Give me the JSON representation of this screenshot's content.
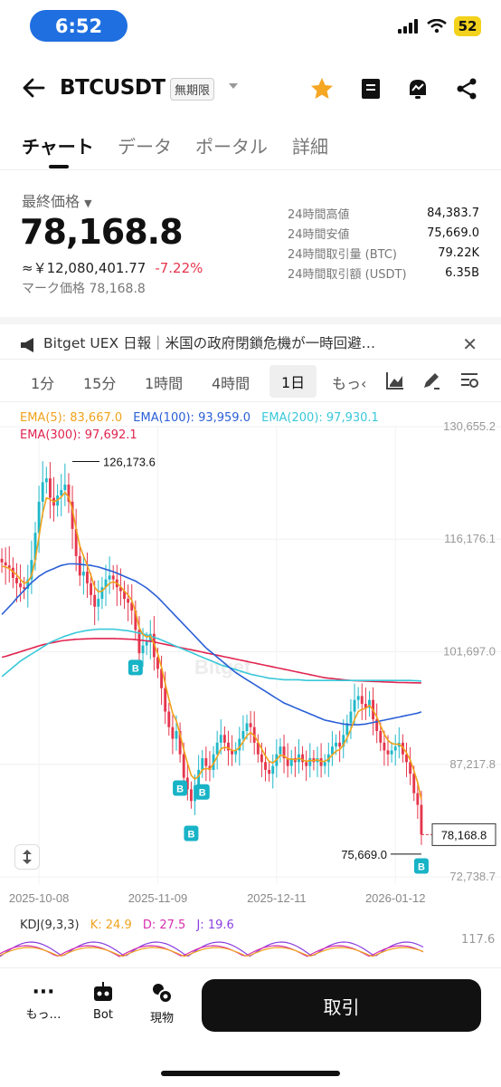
{
  "status_bar": {
    "time": "6:52",
    "battery": "52"
  },
  "header": {
    "symbol": "BTCUSDT",
    "contract_tag": "無期限"
  },
  "tabs": [
    {
      "label": "チャート",
      "active": true
    },
    {
      "label": "データ",
      "active": false
    },
    {
      "label": "ポータル",
      "active": false
    },
    {
      "label": "詳細",
      "active": false
    }
  ],
  "price": {
    "last_label": "最終価格",
    "last_price": "78,168.8",
    "yen_price": "≈￥12,080,401.77",
    "change_pct": "-7.22%",
    "mark_label": "マーク価格",
    "mark_price": "78,168.8"
  },
  "stats": [
    {
      "label": "24時間高値",
      "value": "84,383.7"
    },
    {
      "label": "24時間安値",
      "value": "75,669.0"
    },
    {
      "label": "24時間取引量 (BTC)",
      "value": "79.22K"
    },
    {
      "label": "24時間取引額 (USDT)",
      "value": "6.35B"
    }
  ],
  "news": {
    "text": "Bitget UEX 日報｜米国の政府閉鎖危機が一時回避…"
  },
  "intervals": [
    {
      "label": "1分",
      "active": false
    },
    {
      "label": "15分",
      "active": false
    },
    {
      "label": "1時間",
      "active": false
    },
    {
      "label": "4時間",
      "active": false
    },
    {
      "label": "1日",
      "active": true
    },
    {
      "label": "もっ‹",
      "active": false
    }
  ],
  "colors": {
    "up": "#1fb8c9",
    "down": "#e5364d",
    "ema5": "#f0a21c",
    "ema100": "#2a5fd6",
    "ema200": "#39c8d9",
    "ema300": "#e0244f",
    "kdj_k": "#f0a21c",
    "kdj_d": "#d62fb0",
    "kdj_j": "#8a3fe0"
  },
  "ema_legend": [
    {
      "text": "EMA(5): 83,667.0",
      "color": "#f0a21c"
    },
    {
      "text": "EMA(100): 93,959.0",
      "color": "#2a5fd6"
    },
    {
      "text": "EMA(200): 97,930.1",
      "color": "#39c8d9"
    },
    {
      "text": "EMA(300): 97,692.1",
      "color": "#e0244f"
    }
  ],
  "watermark": "Bitget",
  "chart_data": {
    "type": "candlestick",
    "y_ticks": [
      130655.2,
      116176.1,
      101697.0,
      87217.8,
      72738.7
    ],
    "y_tick_labels": [
      "130,655.2",
      "116,176.1",
      "101,697.0",
      "87,217.8",
      "72,738.7"
    ],
    "ylim": [
      72738.7,
      130655.2
    ],
    "x_tick_labels": [
      "2025-10-08",
      "2025-11-09",
      "2025-12-11",
      "2026-01-12"
    ],
    "x_tick_index": [
      10,
      42,
      74,
      106
    ],
    "high_label": "126,173.6",
    "high_value": 126173.6,
    "high_index": 19,
    "low_label": "75,669.0",
    "low_value": 75669.0,
    "current_label": "78,168.8",
    "current_value": 78168.8,
    "closes": [
      113200,
      112800,
      112500,
      111200,
      110500,
      110000,
      109800,
      111000,
      113500,
      117000,
      121000,
      123500,
      124000,
      121500,
      120500,
      121800,
      122500,
      123200,
      121000,
      117500,
      114000,
      111500,
      112000,
      110500,
      109000,
      107500,
      108500,
      110000,
      111000,
      111500,
      111000,
      110000,
      109500,
      108500,
      108000,
      107000,
      104500,
      101500,
      102500,
      103000,
      104000,
      101000,
      99500,
      97000,
      94000,
      92000,
      90500,
      91500,
      88500,
      85500,
      84000,
      82500,
      84500,
      86500,
      88000,
      87000,
      86500,
      88500,
      90000,
      91000,
      90000,
      89000,
      88500,
      89000,
      90500,
      91500,
      92500,
      92000,
      90000,
      88500,
      87500,
      86500,
      86000,
      87000,
      88500,
      89500,
      88000,
      87000,
      88000,
      87500,
      88500,
      87500,
      87000,
      88000,
      87500,
      88000,
      87000,
      87500,
      88500,
      89500,
      90000,
      89500,
      91000,
      92500,
      94000,
      95500,
      96000,
      95000,
      94500,
      95500,
      93000,
      91500,
      90000,
      89000,
      88500,
      89000,
      89500,
      90000,
      88500,
      87500,
      86000,
      83500,
      82000,
      78168.8
    ],
    "ema5": [
      112700,
      112600,
      112400,
      112000,
      111600,
      111000,
      110500,
      110700,
      111500,
      113500,
      116500,
      119500,
      121500,
      121300,
      121000,
      121200,
      121600,
      122200,
      121600,
      120000,
      117500,
      115300,
      114000,
      112800,
      111500,
      110000,
      109400,
      109500,
      110000,
      110500,
      110700,
      110500,
      110100,
      109500,
      109000,
      108300,
      106900,
      104800,
      103900,
      103600,
      103700,
      102700,
      101400,
      99700,
      97600,
      95600,
      93800,
      92800,
      91100,
      89100,
      87400,
      85800,
      85300,
      85700,
      86500,
      86700,
      86600,
      87300,
      88200,
      89200,
      89400,
      89300,
      89000,
      89000,
      89400,
      90100,
      90900,
      91300,
      90900,
      90100,
      89200,
      88300,
      87600,
      87400,
      87800,
      88400,
      88300,
      87900,
      87900,
      87800,
      88000,
      87800,
      87600,
      87700,
      87700,
      87800,
      87600,
      87600,
      87900,
      88400,
      88900,
      89100,
      89700,
      90600,
      91700,
      93000,
      94000,
      94300,
      94400,
      94800,
      94200,
      93300,
      92200,
      91100,
      90300,
      89900,
      89800,
      89800,
      89400,
      88700,
      87800,
      86400,
      84900,
      82700
    ],
    "ema100": [
      106500,
      107000,
      107500,
      108000,
      108600,
      109100,
      109600,
      110100,
      110600,
      111000,
      111400,
      111700,
      112000,
      112200,
      112400,
      112600,
      112800,
      112900,
      113000,
      113000,
      113000,
      112950,
      112900,
      112850,
      112800,
      112700,
      112600,
      112450,
      112300,
      112150,
      112000,
      111800,
      111600,
      111400,
      111200,
      111000,
      110800,
      110500,
      110200,
      109900,
      109500,
      109100,
      108700,
      108200,
      107700,
      107200,
      106700,
      106200,
      105700,
      105200,
      104700,
      104200,
      103700,
      103200,
      102700,
      102200,
      101800,
      101400,
      101000,
      100600,
      100200,
      99800,
      99400,
      99000,
      98700,
      98400,
      98100,
      97800,
      97500,
      97200,
      96900,
      96600,
      96300,
      96000,
      95700,
      95400,
      95100,
      94900,
      94700,
      94500,
      94300,
      94100,
      93900,
      93700,
      93500,
      93300,
      93100,
      92900,
      92800,
      92700,
      92600,
      92500,
      92400,
      92350,
      92300,
      92300,
      92300,
      92350,
      92400,
      92500,
      92600,
      92700,
      92800,
      92900,
      93000,
      93100,
      93200,
      93300,
      93400,
      93500,
      93600,
      93700,
      93800,
      93959
    ],
    "ema200": [
      98500,
      98900,
      99300,
      99700,
      100100,
      100500,
      100800,
      101100,
      101400,
      101700,
      102000,
      102300,
      102600,
      102900,
      103100,
      103300,
      103500,
      103700,
      103850,
      104000,
      104150,
      104250,
      104350,
      104450,
      104500,
      104550,
      104600,
      104600,
      104600,
      104600,
      104600,
      104550,
      104500,
      104450,
      104400,
      104300,
      104200,
      104100,
      104000,
      103850,
      103700,
      103550,
      103400,
      103200,
      103000,
      102800,
      102600,
      102400,
      102200,
      102000,
      101800,
      101600,
      101400,
      101200,
      101000,
      100800,
      100600,
      100400,
      100200,
      100000,
      99850,
      99700,
      99550,
      99400,
      99250,
      99100,
      98950,
      98800,
      98700,
      98600,
      98500,
      98400,
      98300,
      98250,
      98200,
      98150,
      98100,
      98100,
      98100,
      98100,
      98100,
      98050,
      98000,
      98000,
      98000,
      98000,
      98000,
      98000,
      98000,
      98000,
      98000,
      98000,
      98000,
      98000,
      98000,
      98000,
      98000,
      98000,
      98000,
      98000,
      98000,
      98000,
      98000,
      98000,
      98000,
      98000,
      98000,
      98000,
      98000,
      98000,
      98000,
      97980,
      97960,
      97930.1
    ],
    "ema300": [
      101000,
      101100,
      101250,
      101400,
      101550,
      101700,
      101850,
      102000,
      102150,
      102300,
      102450,
      102600,
      102700,
      102800,
      102900,
      103000,
      103100,
      103150,
      103200,
      103250,
      103300,
      103320,
      103340,
      103360,
      103380,
      103400,
      103400,
      103400,
      103400,
      103400,
      103400,
      103380,
      103360,
      103340,
      103320,
      103300,
      103250,
      103200,
      103150,
      103100,
      103050,
      102950,
      102850,
      102750,
      102650,
      102550,
      102450,
      102350,
      102250,
      102150,
      102050,
      101950,
      101850,
      101750,
      101650,
      101550,
      101450,
      101350,
      101250,
      101150,
      101050,
      100950,
      100850,
      100750,
      100650,
      100550,
      100450,
      100350,
      100250,
      100150,
      100050,
      99950,
      99850,
      99750,
      99650,
      99550,
      99450,
      99350,
      99250,
      99150,
      99050,
      98950,
      98850,
      98750,
      98650,
      98550,
      98450,
      98350,
      98300,
      98250,
      98200,
      98150,
      98100,
      98050,
      98000,
      97980,
      97960,
      97940,
      97920,
      97900,
      97880,
      97860,
      97840,
      97820,
      97800,
      97780,
      97760,
      97740,
      97730,
      97720,
      97710,
      97700,
      97695,
      97692.1
    ],
    "buy_markers": [
      36,
      48,
      51,
      54,
      113
    ],
    "kdj": {
      "k": 24.9,
      "d": 27.5,
      "j": 19.6,
      "y_tick": 117.6
    }
  },
  "kdj_labels": {
    "name": "KDJ(9,3,3)",
    "k": "K: 24.9",
    "d": "D: 27.5",
    "j": "J: 19.6",
    "tick": "117.6"
  },
  "bottom_nav": [
    {
      "label": "もっ…",
      "icon": "more-dots-icon"
    },
    {
      "label": "Bot",
      "icon": "bot-icon"
    },
    {
      "label": "現物",
      "icon": "spot-icon"
    }
  ],
  "trade_button": "取引"
}
